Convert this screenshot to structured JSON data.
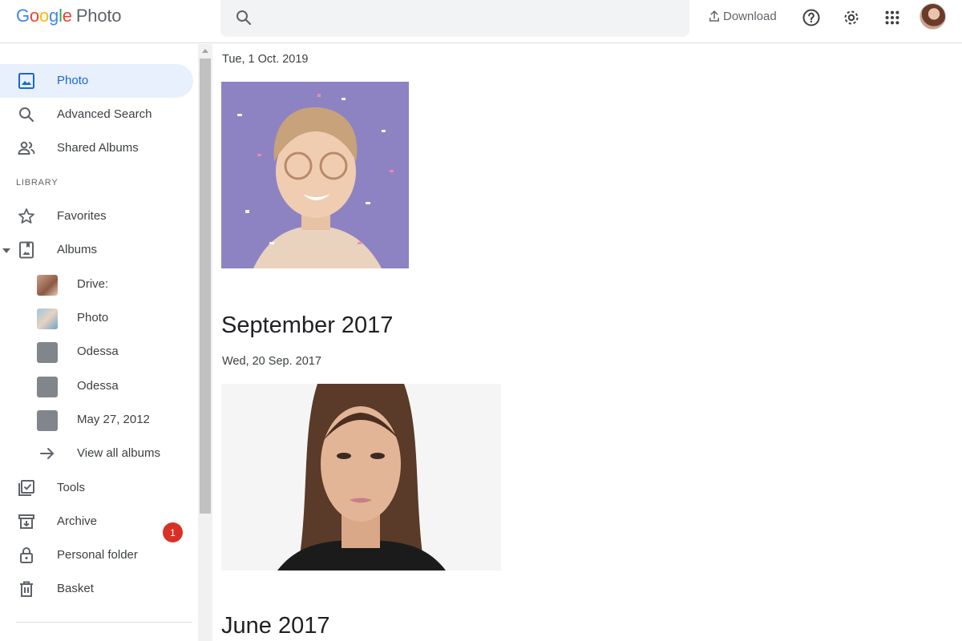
{
  "header": {
    "logo_google": "Google",
    "logo_product": "Photo",
    "search_placeholder": "",
    "download_label": "Download",
    "icons": [
      "search-icon",
      "upload-icon",
      "help-icon",
      "settings-icon",
      "apps-icon"
    ]
  },
  "sidebar": {
    "items": [
      {
        "label": "Photo",
        "icon": "photo-icon",
        "active": true
      },
      {
        "label": "Advanced Search",
        "icon": "search-icon"
      },
      {
        "label": "Shared Albums",
        "icon": "people-icon"
      }
    ],
    "library_heading": "LIBRARY",
    "library_items": [
      {
        "label": "Favorites",
        "icon": "star-icon"
      },
      {
        "label": "Albums",
        "icon": "album-icon"
      }
    ],
    "albums": [
      {
        "label": "Drive:"
      },
      {
        "label": "Photo"
      },
      {
        "label": "Odessa"
      },
      {
        "label": "Odessa"
      },
      {
        "label": "May 27, 2012"
      }
    ],
    "view_all_albums": "View all albums",
    "tools": {
      "label": "Tools",
      "badge": "1"
    },
    "more_items": [
      {
        "label": "Archive",
        "icon": "archive-icon"
      },
      {
        "label": "Personal folder",
        "icon": "lock-icon"
      },
      {
        "label": "Basket",
        "icon": "trash-icon"
      }
    ]
  },
  "main": {
    "group1": {
      "date": "Tue, 1 Oct. 2019"
    },
    "group2": {
      "month": "September 2017",
      "date": "Wed, 20 Sep. 2017"
    },
    "group3": {
      "month": "June 2017"
    }
  },
  "colors": {
    "accent": "#1967d2",
    "active_bg": "#e8f0fe",
    "badge": "#d93025"
  }
}
